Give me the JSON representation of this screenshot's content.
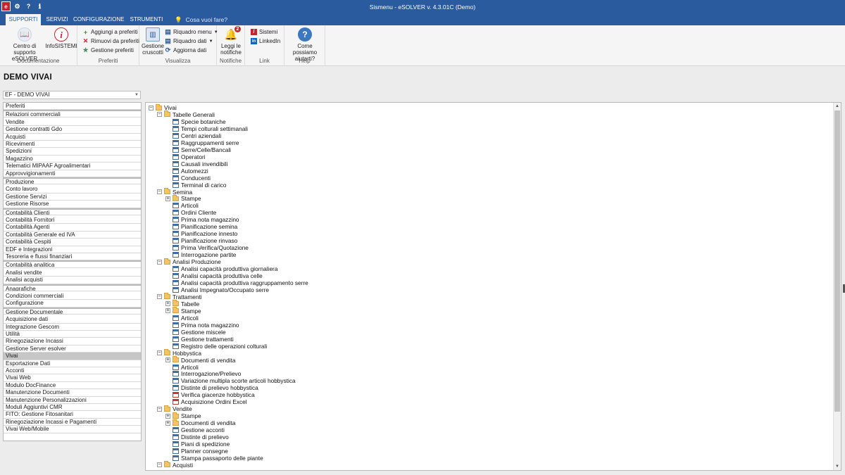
{
  "window": {
    "title": "Sismenu - eSOLVER v. 4.3.01C  (Demo)"
  },
  "ribbon_tabs": [
    {
      "label": "SUPPORTI",
      "active": true
    },
    {
      "label": "SERVIZI",
      "active": false
    },
    {
      "label": "CONFIGURAZIONE",
      "active": false
    },
    {
      "label": "STRUMENTI",
      "active": false
    }
  ],
  "search": {
    "placeholder": "Cosa vuoi fare?"
  },
  "ribbon": {
    "documentazione": {
      "label": "Documentazione",
      "centro": "Centro di supporto eSOLVER",
      "infosistemi": "InfoSISTEMI"
    },
    "preferiti": {
      "label": "Preferiti",
      "aggiungi": "Aggiungi a preferiti",
      "rimuovi": "Rimuovi da preferiti",
      "gestione": "Gestione preferiti"
    },
    "visualizza": {
      "label": "Visualizza",
      "cruscotti": "Gestione cruscotti",
      "riquadro_menu": "Riquadro menu",
      "riquadro_dati": "Riquadro dati",
      "aggiorna": "Aggiorna dati"
    },
    "notifiche": {
      "label": "Notifiche",
      "leggi": "Leggi le notifiche",
      "badge": "2"
    },
    "link": {
      "label": "Link",
      "sistemi": "Sistemi",
      "linkedin": "LinkedIn"
    },
    "help": {
      "label": "Help",
      "aiuto": "Come possiamo aiutarti?"
    }
  },
  "page": {
    "title": "DEMO VIVAI"
  },
  "company": {
    "selected": "EF - DEMO VIVAI"
  },
  "nav_items": [
    {
      "label": "Preferiti",
      "group_start": false,
      "selected": false
    },
    {
      "label": "Relazioni commerciali",
      "group_start": true,
      "selected": false
    },
    {
      "label": "Vendite",
      "group_start": false,
      "selected": false
    },
    {
      "label": "Gestione contratti Gdo",
      "group_start": false,
      "selected": false
    },
    {
      "label": "Acquisti",
      "group_start": false,
      "selected": false
    },
    {
      "label": "Ricevimenti",
      "group_start": false,
      "selected": false
    },
    {
      "label": "Spedizioni",
      "group_start": false,
      "selected": false
    },
    {
      "label": "Magazzino",
      "group_start": false,
      "selected": false
    },
    {
      "label": "Telematici MIPAAF Agroalimentari",
      "group_start": false,
      "selected": false
    },
    {
      "label": "Approvvigionamenti",
      "group_start": false,
      "selected": false
    },
    {
      "label": "Produzione",
      "group_start": true,
      "selected": false
    },
    {
      "label": "Conto lavoro",
      "group_start": false,
      "selected": false
    },
    {
      "label": "Gestione Servizi",
      "group_start": false,
      "selected": false
    },
    {
      "label": "Gestione Risorse",
      "group_start": false,
      "selected": false
    },
    {
      "label": "Contabilità Clienti",
      "group_start": true,
      "selected": false
    },
    {
      "label": "Contabilità Fornitori",
      "group_start": false,
      "selected": false
    },
    {
      "label": "Contabilità Agenti",
      "group_start": false,
      "selected": false
    },
    {
      "label": "Contabilità Generale ed IVA",
      "group_start": false,
      "selected": false
    },
    {
      "label": "Contabilità Cespiti",
      "group_start": false,
      "selected": false
    },
    {
      "label": "EDF e Integrazioni",
      "group_start": false,
      "selected": false
    },
    {
      "label": "Tesoreria e flussi finanziari",
      "group_start": false,
      "selected": false
    },
    {
      "label": "Contabilità analitica",
      "group_start": true,
      "selected": false
    },
    {
      "label": "Analisi vendite",
      "group_start": false,
      "selected": false
    },
    {
      "label": "Analisi acquisti",
      "group_start": false,
      "selected": false
    },
    {
      "label": "Anagrafiche",
      "group_start": true,
      "selected": false
    },
    {
      "label": "Condizioni commerciali",
      "group_start": false,
      "selected": false
    },
    {
      "label": "Configurazione",
      "group_start": false,
      "selected": false
    },
    {
      "label": "Gestione Documentale",
      "group_start": true,
      "selected": false
    },
    {
      "label": "Acquisizione dati",
      "group_start": false,
      "selected": false
    },
    {
      "label": "Integrazione Gescom",
      "group_start": false,
      "selected": false
    },
    {
      "label": "Utilità",
      "group_start": false,
      "selected": false
    },
    {
      "label": "Rinegoziazione Incassi",
      "group_start": false,
      "selected": false
    },
    {
      "label": "Gestione Server esolver",
      "group_start": false,
      "selected": false
    },
    {
      "label": "Vivai",
      "group_start": false,
      "selected": true
    },
    {
      "label": "Esportazione Dati",
      "group_start": false,
      "selected": false
    },
    {
      "label": "Acconti",
      "group_start": false,
      "selected": false
    },
    {
      "label": "Vivai Web",
      "group_start": false,
      "selected": false
    },
    {
      "label": "Modulo DocFinance",
      "group_start": false,
      "selected": false
    },
    {
      "label": "Manutenzione Documenti",
      "group_start": false,
      "selected": false
    },
    {
      "label": "Manutenzione Personalizzazioni",
      "group_start": false,
      "selected": false
    },
    {
      "label": "Moduli Aggiuntivi CMR",
      "group_start": false,
      "selected": false
    },
    {
      "label": "FITO: Gestione Fitosanitari",
      "group_start": false,
      "selected": false
    },
    {
      "label": "Rinegoziazione Incassi e Pagamenti",
      "group_start": false,
      "selected": false
    },
    {
      "label": "Vivai Web/Mobile",
      "group_start": false,
      "selected": false
    }
  ],
  "tree": [
    {
      "label": "Vivai",
      "level": 0,
      "kind": "folder",
      "expander": "−"
    },
    {
      "label": "Tabelle Generali",
      "level": 1,
      "kind": "folder",
      "expander": "−"
    },
    {
      "label": "Specie botaniche",
      "level": 2,
      "kind": "doc"
    },
    {
      "label": "Tempi colturali settimanali",
      "level": 2,
      "kind": "doc"
    },
    {
      "label": "Centri aziendali",
      "level": 2,
      "kind": "doc"
    },
    {
      "label": "Raggruppamenti serre",
      "level": 2,
      "kind": "doc"
    },
    {
      "label": "Serre/Celle/Bancali",
      "level": 2,
      "kind": "doc"
    },
    {
      "label": "Operatori",
      "level": 2,
      "kind": "doc"
    },
    {
      "label": "Causali invendibili",
      "level": 2,
      "kind": "doc"
    },
    {
      "label": "Automezzi",
      "level": 2,
      "kind": "doc"
    },
    {
      "label": "Conducenti",
      "level": 2,
      "kind": "doc"
    },
    {
      "label": "Terminal di carico",
      "level": 2,
      "kind": "doc"
    },
    {
      "label": "Semina",
      "level": 1,
      "kind": "folder",
      "expander": "−"
    },
    {
      "label": "Stampe",
      "level": 2,
      "kind": "folder",
      "expander": "+"
    },
    {
      "label": "Articoli",
      "level": 2,
      "kind": "doc"
    },
    {
      "label": "Ordini Cliente",
      "level": 2,
      "kind": "doc"
    },
    {
      "label": "Prima nota magazzino",
      "level": 2,
      "kind": "doc"
    },
    {
      "label": "Pianificazione semina",
      "level": 2,
      "kind": "doc"
    },
    {
      "label": "Pianificazione innesto",
      "level": 2,
      "kind": "doc"
    },
    {
      "label": "Pianificazione rinvaso",
      "level": 2,
      "kind": "doc"
    },
    {
      "label": "Prima Verifica/Quotazione",
      "level": 2,
      "kind": "doc"
    },
    {
      "label": "Interrogazione partite",
      "level": 2,
      "kind": "doc"
    },
    {
      "label": "Analisi Produzione",
      "level": 1,
      "kind": "folder",
      "expander": "−"
    },
    {
      "label": "Analisi capacità produttiva giornaliera",
      "level": 2,
      "kind": "doc"
    },
    {
      "label": "Analisi capacità produttiva celle",
      "level": 2,
      "kind": "doc"
    },
    {
      "label": "Analisi capacità produttiva raggruppamento serre",
      "level": 2,
      "kind": "doc"
    },
    {
      "label": "Analisi Impegnato/Occupato serre",
      "level": 2,
      "kind": "doc"
    },
    {
      "label": "Trattamenti",
      "level": 1,
      "kind": "folder",
      "expander": "−"
    },
    {
      "label": "Tabelle",
      "level": 2,
      "kind": "folder",
      "expander": "+"
    },
    {
      "label": "Stampe",
      "level": 2,
      "kind": "folder",
      "expander": "+"
    },
    {
      "label": "Articoli",
      "level": 2,
      "kind": "doc"
    },
    {
      "label": "Prima nota magazzino",
      "level": 2,
      "kind": "doc"
    },
    {
      "label": "Gestione miscele",
      "level": 2,
      "kind": "doc"
    },
    {
      "label": "Gestione trattamenti",
      "level": 2,
      "kind": "doc"
    },
    {
      "label": "Registro delle operazioni colturali",
      "level": 2,
      "kind": "doc"
    },
    {
      "label": "Hobbystica",
      "level": 1,
      "kind": "folder",
      "expander": "−"
    },
    {
      "label": "Documenti di vendita",
      "level": 2,
      "kind": "folder",
      "expander": "+"
    },
    {
      "label": "Articoli",
      "level": 2,
      "kind": "doc"
    },
    {
      "label": "Interrogazione/Prelievo",
      "level": 2,
      "kind": "doc"
    },
    {
      "label": "Variazione multipla scorte articoli hobbystica",
      "level": 2,
      "kind": "doc"
    },
    {
      "label": "Distinte di prelievo hobbystica",
      "level": 2,
      "kind": "doc"
    },
    {
      "label": "Verifica giacenze hobbystica",
      "level": 2,
      "kind": "doc-special"
    },
    {
      "label": "Acquisizione Ordini Excel",
      "level": 2,
      "kind": "doc-special"
    },
    {
      "label": "Vendite",
      "level": 1,
      "kind": "folder",
      "expander": "−"
    },
    {
      "label": "Stampe",
      "level": 2,
      "kind": "folder",
      "expander": "+"
    },
    {
      "label": "Documenti di vendita",
      "level": 2,
      "kind": "folder",
      "expander": "+"
    },
    {
      "label": "Gestione acconti",
      "level": 2,
      "kind": "doc"
    },
    {
      "label": "Distinte di prelievo",
      "level": 2,
      "kind": "doc"
    },
    {
      "label": "Piani di spedizione",
      "level": 2,
      "kind": "doc"
    },
    {
      "label": "Planner consegne",
      "level": 2,
      "kind": "doc"
    },
    {
      "label": "Stampa passaporto delle piante",
      "level": 2,
      "kind": "doc"
    },
    {
      "label": "Acquisti",
      "level": 1,
      "kind": "folder",
      "expander": "−"
    }
  ],
  "colors": {
    "titlebar": "#2a5b9e",
    "ribbon": "#f5f5f5",
    "selected_nav": "#c6c6c6",
    "folder": "#f2c463",
    "doc": "#3c6ea8"
  }
}
